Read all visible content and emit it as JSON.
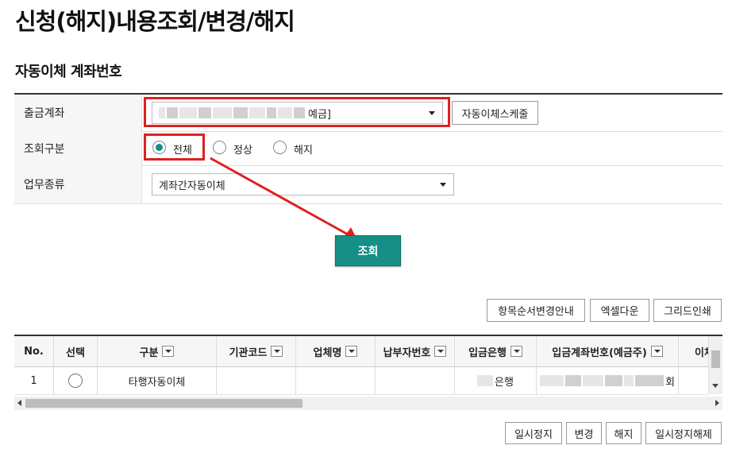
{
  "page": {
    "title": "신청(해지)내용조회/변경/해지"
  },
  "section": {
    "title": "자동이체 계좌번호"
  },
  "form": {
    "account": {
      "label": "출금계좌",
      "value_suffix": "예금]",
      "schedule_button": "자동이체스케줄"
    },
    "inquiry_type": {
      "label": "조회구분",
      "options": [
        "전체",
        "정상",
        "해지"
      ],
      "selected": "전체"
    },
    "business_type": {
      "label": "업무종류",
      "value": "계좌간자동이체"
    }
  },
  "search_button": "조회",
  "grid_toolbar": {
    "column_order_guide": "항목순서변경안내",
    "excel_download": "엑셀다운",
    "grid_print": "그리드인쇄"
  },
  "table": {
    "columns": [
      "No.",
      "선택",
      "구분",
      "기관코드",
      "업체명",
      "납부자번호",
      "입금은행",
      "입금계좌번호(예금주)",
      "이체"
    ],
    "rows": [
      {
        "no": "1",
        "type": "타행자동이체",
        "bank_suffix": "은행",
        "account_suffix": "회"
      }
    ]
  },
  "bottom_buttons": {
    "pause": "일시정지",
    "change": "변경",
    "cancel": "해지",
    "resume": "일시정지해제"
  },
  "colors": {
    "accent": "#168f86",
    "highlight": "#e02020"
  }
}
